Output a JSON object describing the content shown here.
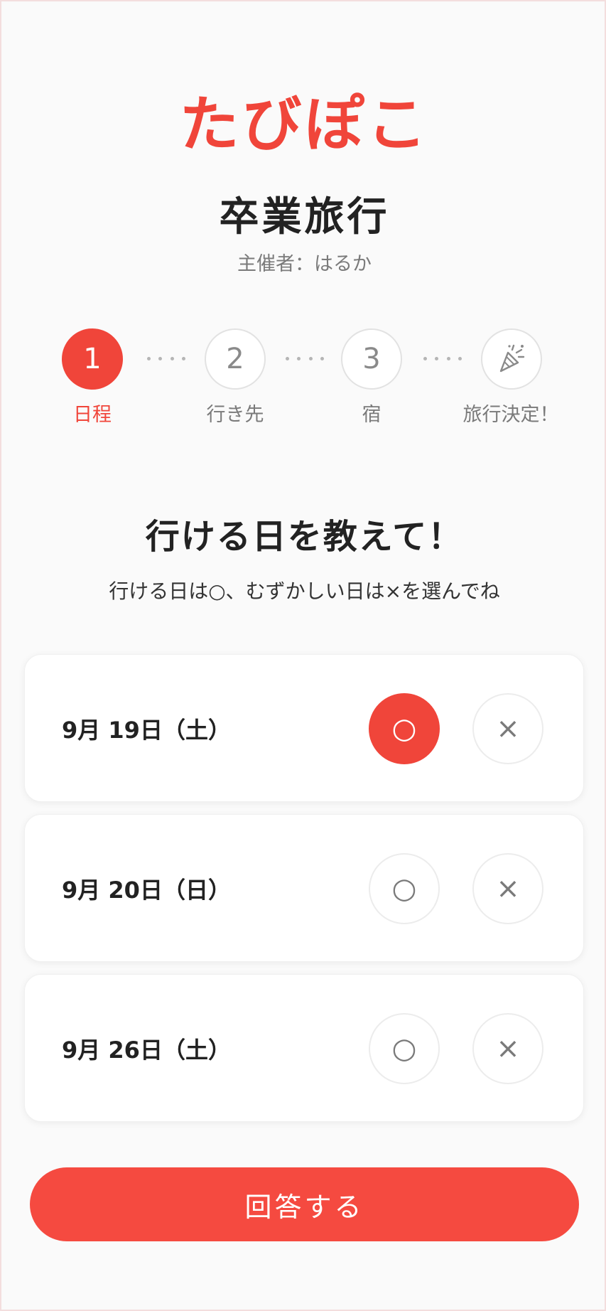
{
  "app": {
    "logo": "たびぽこ"
  },
  "trip": {
    "title": "卒業旅行",
    "organizer": "主催者：はるか"
  },
  "steps": [
    {
      "number": "1",
      "label": "日程",
      "active": true
    },
    {
      "number": "2",
      "label": "行き先",
      "active": false
    },
    {
      "number": "3",
      "label": "宿",
      "active": false
    },
    {
      "icon": "party-popper-icon",
      "label": "旅行決定！",
      "active": false
    }
  ],
  "question": {
    "heading": "行ける日を教えて！",
    "hint": "行ける日は○、むずかしい日は×を選んでね"
  },
  "dates": [
    {
      "label": "9月 19日（土）",
      "yes": "○",
      "no": "×",
      "selected": "yes"
    },
    {
      "label": "9月 20日（日）",
      "yes": "○",
      "no": "×",
      "selected": "none"
    },
    {
      "label": "9月 26日（土）",
      "yes": "○",
      "no": "×",
      "selected": "none"
    }
  ],
  "submit": {
    "label": "回答する"
  },
  "colors": {
    "accent": "#f0453a",
    "muted": "#7a7a7a",
    "text": "#222222"
  }
}
